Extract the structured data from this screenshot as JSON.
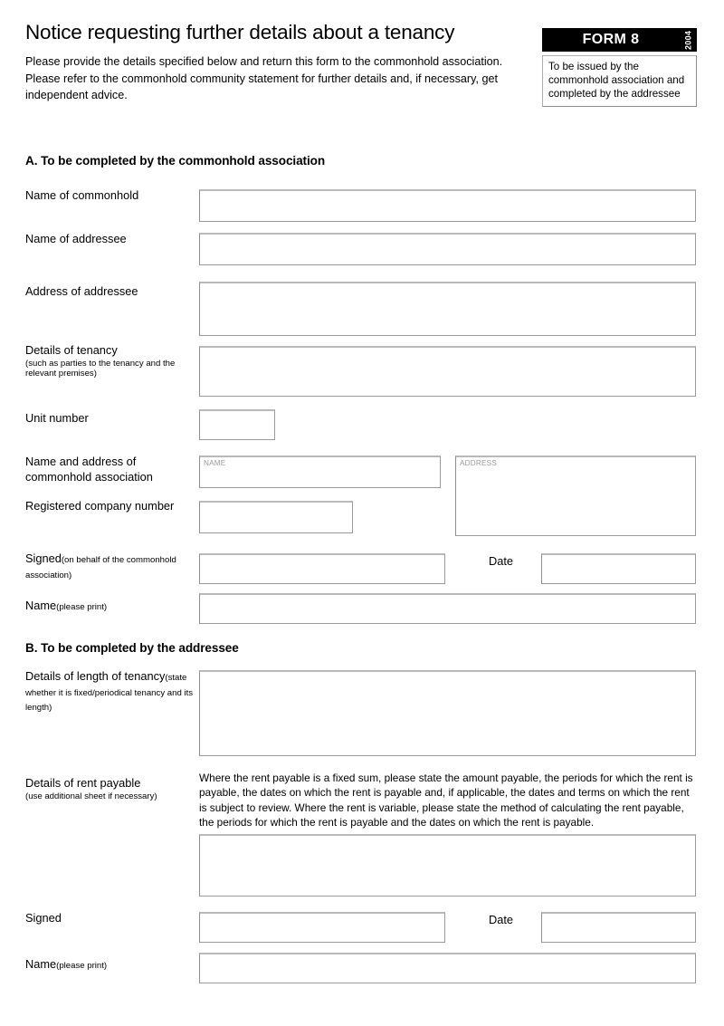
{
  "header": {
    "title": "Notice requesting further details about a tenancy",
    "intro": "Please provide the details specified below and return this form to the commonhold association. Please refer to the commonhold community statement for further details and, if necessary, get independent advice."
  },
  "badge": {
    "label": "FORM 8",
    "year": "2004",
    "note": "To be issued by the commonhold association and completed by the addressee"
  },
  "sections": [
    {
      "id": "a",
      "heading": "A. To be completed by the commonhold association",
      "fields": [
        {
          "id": "name_of_commonhold",
          "label": "Name of commonhold",
          "value": ""
        },
        {
          "id": "name_of_addressee",
          "label": "Name of addressee",
          "value": ""
        },
        {
          "id": "address_of_addressee",
          "label": "Address of addressee",
          "value": ""
        },
        {
          "id": "details_of_tenancy",
          "label": "Details of tenancy",
          "sub": "(such as parties to the tenancy and the relevant premises)",
          "value": ""
        },
        {
          "id": "unit_number",
          "label": "Unit number",
          "value": ""
        },
        {
          "id": "name_address_commonhold_association",
          "label": "Name and address of commonhold association",
          "name_placeholder": "NAME",
          "address_placeholder": "ADDRESS",
          "name_value": "",
          "address_value": ""
        },
        {
          "id": "registered_company_number",
          "label": "Registered company number",
          "value": ""
        },
        {
          "id": "signed_a",
          "label": "Signed",
          "sub": "(on behalf of the commonhold association)",
          "value": "",
          "date_label": "Date",
          "date_value": ""
        },
        {
          "id": "name_print_a",
          "label": "Name",
          "sub": "(please print)",
          "value": ""
        }
      ]
    },
    {
      "id": "b",
      "heading": "B. To be completed by the addressee",
      "fields": [
        {
          "id": "details_length_tenancy",
          "label": "Details of length of tenancy",
          "sub": "(state whether it is fixed/periodical tenancy and its length)",
          "value": ""
        },
        {
          "id": "details_rent_payable",
          "label": "Details of rent payable",
          "sub": "(use additional sheet if necessary)",
          "instruction": "Where the rent payable is a fixed sum, please state the amount payable, the periods for which the rent is payable, the dates on which the rent is payable and, if applicable, the dates and terms on which the rent is subject to review. Where the rent is variable, please state the method of calculating the rent payable, the periods for which the rent is payable and the dates on which the rent is payable.",
          "value": ""
        },
        {
          "id": "signed_b",
          "label": "Signed",
          "value": "",
          "date_label": "Date",
          "date_value": ""
        },
        {
          "id": "name_print_b",
          "label": "Name",
          "sub": "(please print)",
          "value": ""
        }
      ]
    }
  ],
  "colors": {
    "badge_background": "#000000",
    "badge_text": "#ffffff",
    "box_border": "#9b9b9b",
    "placeholder_text": "#9a9a9a",
    "page_background": "#ffffff"
  }
}
